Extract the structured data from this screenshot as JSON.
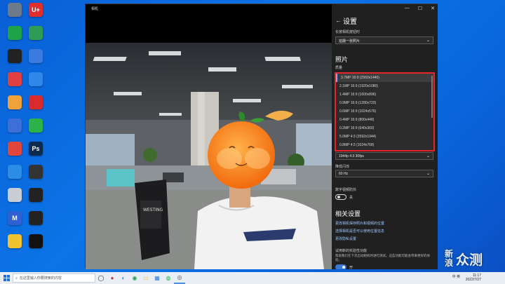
{
  "desktop": {
    "icons": [
      {
        "label": "",
        "glyph": "",
        "color": "#6c7a8a"
      },
      {
        "label": "",
        "glyph": "U+",
        "color": "#e02d2d"
      },
      {
        "label": "",
        "glyph": "",
        "color": "#1fa34a"
      },
      {
        "label": "",
        "glyph": "",
        "color": "#2f9b55"
      },
      {
        "label": "",
        "glyph": "",
        "color": "#222222"
      },
      {
        "label": "",
        "glyph": "",
        "color": "#3b7be0"
      },
      {
        "label": "",
        "glyph": "",
        "color": "#e24040"
      },
      {
        "label": "",
        "glyph": "",
        "color": "#2e88e8"
      },
      {
        "label": "",
        "glyph": "",
        "color": "#f0a13a"
      },
      {
        "label": "",
        "glyph": "",
        "color": "#d92b2b"
      },
      {
        "label": "",
        "glyph": "",
        "color": "#3d6fd8"
      },
      {
        "label": "",
        "glyph": "",
        "color": "#2bb34a"
      },
      {
        "label": "",
        "glyph": "",
        "color": "#e0463a"
      },
      {
        "label": "",
        "glyph": "Ps",
        "color": "#0d2b4e"
      },
      {
        "label": "",
        "glyph": "",
        "color": "#2c8de6"
      },
      {
        "label": "",
        "glyph": "",
        "color": "#333333"
      },
      {
        "label": "",
        "glyph": "",
        "color": "#c9ced6"
      },
      {
        "label": "",
        "glyph": "",
        "color": "#222222"
      },
      {
        "label": "",
        "glyph": "M",
        "color": "#2f5fd3"
      },
      {
        "label": "",
        "glyph": "",
        "color": "#222222"
      },
      {
        "label": "",
        "glyph": "",
        "color": "#f3c230"
      },
      {
        "label": "",
        "glyph": "",
        "color": "#111111"
      }
    ]
  },
  "camera_window": {
    "title": "相机",
    "controls": {
      "minimize": "—",
      "maximize": "☐",
      "close": "✕"
    }
  },
  "settings": {
    "title": "设置",
    "back_icon": "back-arrow-icon",
    "camera_mode_label": "长按相机按钮时",
    "camera_mode_value": "拍摄一张照片",
    "photo_section": "照片",
    "quality_label": "质量",
    "quality_options": [
      "3.7MP 16:9 (2560x1440)",
      "2.1MP 16:9 (1920x1080)",
      "1.4MP 16:9 (1600x896)",
      "0.9MP 16:9 (1280x720)",
      "0.6MP 16:9 (1024x576)",
      "0.4MP 16:9 (800x448)",
      "0.2MP 16:9 (640x360)",
      "5.0MP 4:3 (2592x1944)",
      "0.8MP 4:3 (1024x768)"
    ],
    "video_quality_value": "1944p 4:3 30fps",
    "flicker_label": "降低闪烁",
    "flicker_value": "60 Hz",
    "stabilization_label": "数字视频防抖",
    "stabilization_state": "关",
    "related_section": "相关设置",
    "links": [
      "更改相机保存照片和视频的位置",
      "选择相机是否可以使用位置信息",
      "更改隐私设置"
    ],
    "preview_label": "试用新的实验性功能",
    "preview_note": "帮助我们在下次启动相机时进行测试。这些功能可能会带来更好的体验。",
    "preview_toggle_state": "开",
    "highlight_color": "#e8232b"
  },
  "taskbar": {
    "search_placeholder": "在这里输入你要搜索的内容",
    "tray_text": "中  英",
    "time": "11:17",
    "date": "2022/7/27"
  },
  "watermark": {
    "char1": "新",
    "char2": "浪",
    "text": "众测"
  }
}
